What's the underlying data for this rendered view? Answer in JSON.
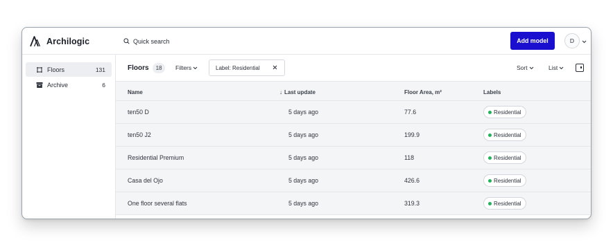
{
  "app": {
    "brand_name": "Archilogic"
  },
  "topbar": {
    "search_label": "Quick search",
    "add_button_label": "Add model",
    "avatar_initial": "D"
  },
  "sidebar": {
    "items": [
      {
        "label": "Floors",
        "count": "131",
        "active": true,
        "icon": "floor-plan-icon"
      },
      {
        "label": "Archive",
        "count": "6",
        "active": false,
        "icon": "archive-box-icon"
      }
    ]
  },
  "toolbar": {
    "title": "Floors",
    "count_badge": "18",
    "filters_label": "Filters",
    "active_filter_chip": "Label: Residential",
    "sort_label": "Sort",
    "view_label": "List"
  },
  "table": {
    "columns": {
      "name": "Name",
      "last_update": "Last update",
      "floor_area": "Floor Area, m²",
      "labels": "Labels"
    },
    "sort_indicator": "↓",
    "rows": [
      {
        "name": "ten50 D",
        "last_update": "5 days ago",
        "floor_area": "77.6",
        "label": "Residential"
      },
      {
        "name": "ten50 J2",
        "last_update": "5 days ago",
        "floor_area": "199.9",
        "label": "Residential"
      },
      {
        "name": "Residential Premium",
        "last_update": "5 days ago",
        "floor_area": "118",
        "label": "Residential"
      },
      {
        "name": "Casa del Ojo",
        "last_update": "5 days ago",
        "floor_area": "426.6",
        "label": "Residential"
      },
      {
        "name": "One floor several flats",
        "last_update": "5 days ago",
        "floor_area": "319.3",
        "label": "Residential"
      }
    ]
  },
  "colors": {
    "accent": "#1a0fcf",
    "label_dot": "#22b35a",
    "row_background": "#f4f5f7"
  }
}
